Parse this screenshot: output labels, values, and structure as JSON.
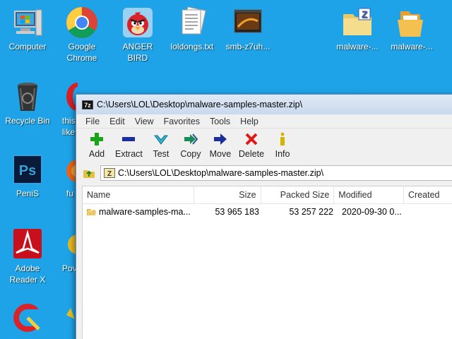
{
  "desktop": {
    "icons": [
      {
        "id": "computer",
        "label": "Computer"
      },
      {
        "id": "chrome",
        "label": "Google\nChrome"
      },
      {
        "id": "anger-bird",
        "label": "ANGER\nBIRD"
      },
      {
        "id": "loldongs",
        "label": "loldongs.txt"
      },
      {
        "id": "smb",
        "label": "smb-z7uh..."
      },
      {
        "id": "malware-zip",
        "label": "malware-..."
      },
      {
        "id": "malware-folder",
        "label": "malware-..."
      },
      {
        "id": "recycle-bin",
        "label": "Recycle Bin"
      },
      {
        "id": "this-like",
        "label": "this\nlike"
      },
      {
        "id": "photoshop",
        "label": "PeniS"
      },
      {
        "id": "fu",
        "label": "fu"
      },
      {
        "id": "adobe-reader",
        "label": "Adobe\nReader X"
      },
      {
        "id": "pow",
        "label": "Pov"
      }
    ]
  },
  "window": {
    "app_icon_text": "7z",
    "title": "C:\\Users\\LOL\\Desktop\\malware-samples-master.zip\\",
    "menu": [
      "File",
      "Edit",
      "View",
      "Favorites",
      "Tools",
      "Help"
    ],
    "toolbar": [
      {
        "id": "add",
        "label": "Add",
        "icon": "plus-icon",
        "color": "#1aa31a"
      },
      {
        "id": "extract",
        "label": "Extract",
        "icon": "minus-icon",
        "color": "#1a2f9c"
      },
      {
        "id": "test",
        "label": "Test",
        "icon": "check-icon",
        "color": "#2aa8c8"
      },
      {
        "id": "copy",
        "label": "Copy",
        "icon": "double-arrow-icon",
        "color": "#1a8a5a"
      },
      {
        "id": "move",
        "label": "Move",
        "icon": "arrow-right-icon",
        "color": "#1a2f9c"
      },
      {
        "id": "delete",
        "label": "Delete",
        "icon": "x-icon",
        "color": "#e01818"
      },
      {
        "id": "info",
        "label": "Info",
        "icon": "info-icon",
        "color": "#d4b400"
      }
    ],
    "address": "C:\\Users\\LOL\\Desktop\\malware-samples-master.zip\\",
    "columns": {
      "name": "Name",
      "size": "Size",
      "packed": "Packed Size",
      "modified": "Modified",
      "created": "Created"
    },
    "rows": [
      {
        "name": "malware-samples-ma...",
        "size": "53 965 183",
        "packed": "53 257 222",
        "modified": "2020-09-30 0..."
      }
    ]
  }
}
